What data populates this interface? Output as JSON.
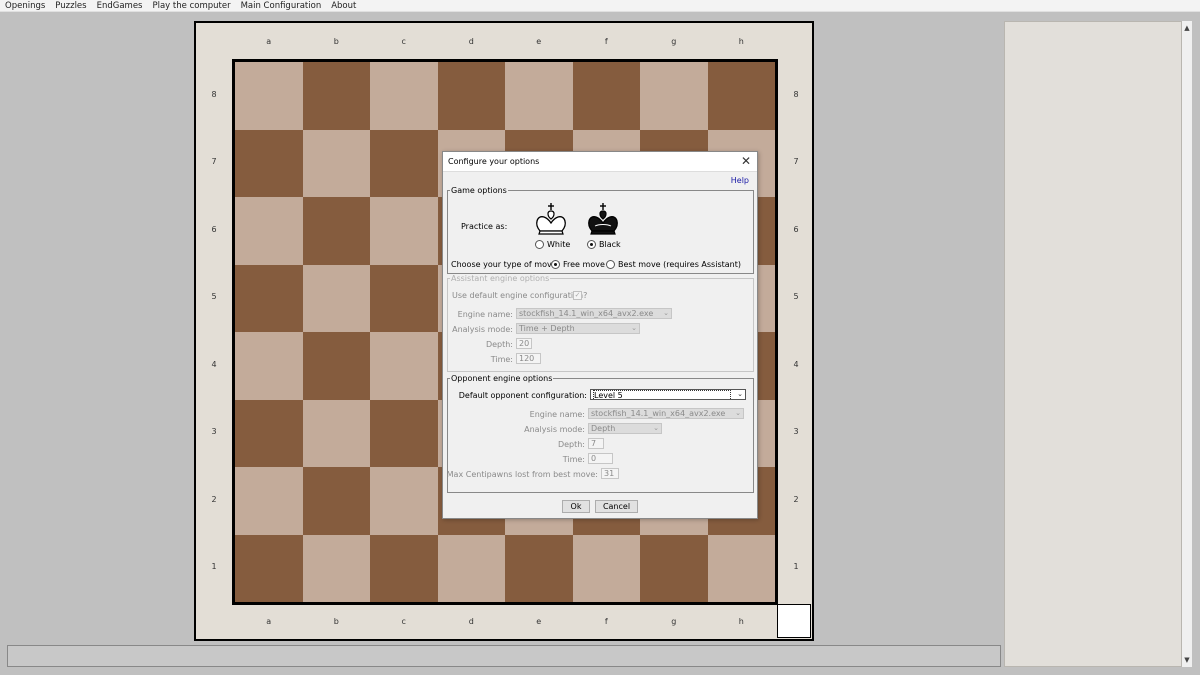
{
  "menu": [
    "Openings",
    "Puzzles",
    "EndGames",
    "Play the computer",
    "Main Configuration",
    "About"
  ],
  "board": {
    "files": [
      "a",
      "b",
      "c",
      "d",
      "e",
      "f",
      "g",
      "h"
    ],
    "ranks": [
      "8",
      "7",
      "6",
      "5",
      "4",
      "3",
      "2",
      "1"
    ],
    "light_color": "#c3ab9a",
    "dark_color": "#855c3e"
  },
  "dialog": {
    "title": "Configure your options",
    "close_glyph": "✕",
    "help": "Help",
    "game_options": {
      "legend": "Game options",
      "practice_as_label": "Practice as:",
      "white_label": "White",
      "black_label": "Black",
      "selected_side": "Black",
      "move_type_label": "Choose your type of move:",
      "free_move_label": "Free move",
      "best_move_label": "Best move (requires Assistant)",
      "selected_move_type": "Free move"
    },
    "assistant": {
      "legend": "Assistant engine options",
      "use_default_label": "Use default engine configuration?",
      "use_default_checked": true,
      "engine_name_label": "Engine name:",
      "engine_name": "stockfish_14.1_win_x64_avx2.exe",
      "analysis_mode_label": "Analysis mode:",
      "analysis_mode": "Time + Depth",
      "depth_label": "Depth:",
      "depth": "20",
      "time_label": "Time:",
      "time": "120"
    },
    "opponent": {
      "legend": "Opponent engine options",
      "default_config_label": "Default opponent configuration:",
      "default_config": "Level 5",
      "engine_name_label": "Engine name:",
      "engine_name": "stockfish_14.1_win_x64_avx2.exe",
      "analysis_mode_label": "Analysis mode:",
      "analysis_mode": "Depth",
      "depth_label": "Depth:",
      "depth": "7",
      "time_label": "Time:",
      "time": "0",
      "max_cp_label": "Max Centipawns lost from best move:",
      "max_cp": "31"
    },
    "ok_label": "Ok",
    "cancel_label": "Cancel"
  },
  "icons": {
    "scroll_up": "▲",
    "scroll_down": "▼",
    "dropdown": "⌄",
    "check": "✓"
  }
}
